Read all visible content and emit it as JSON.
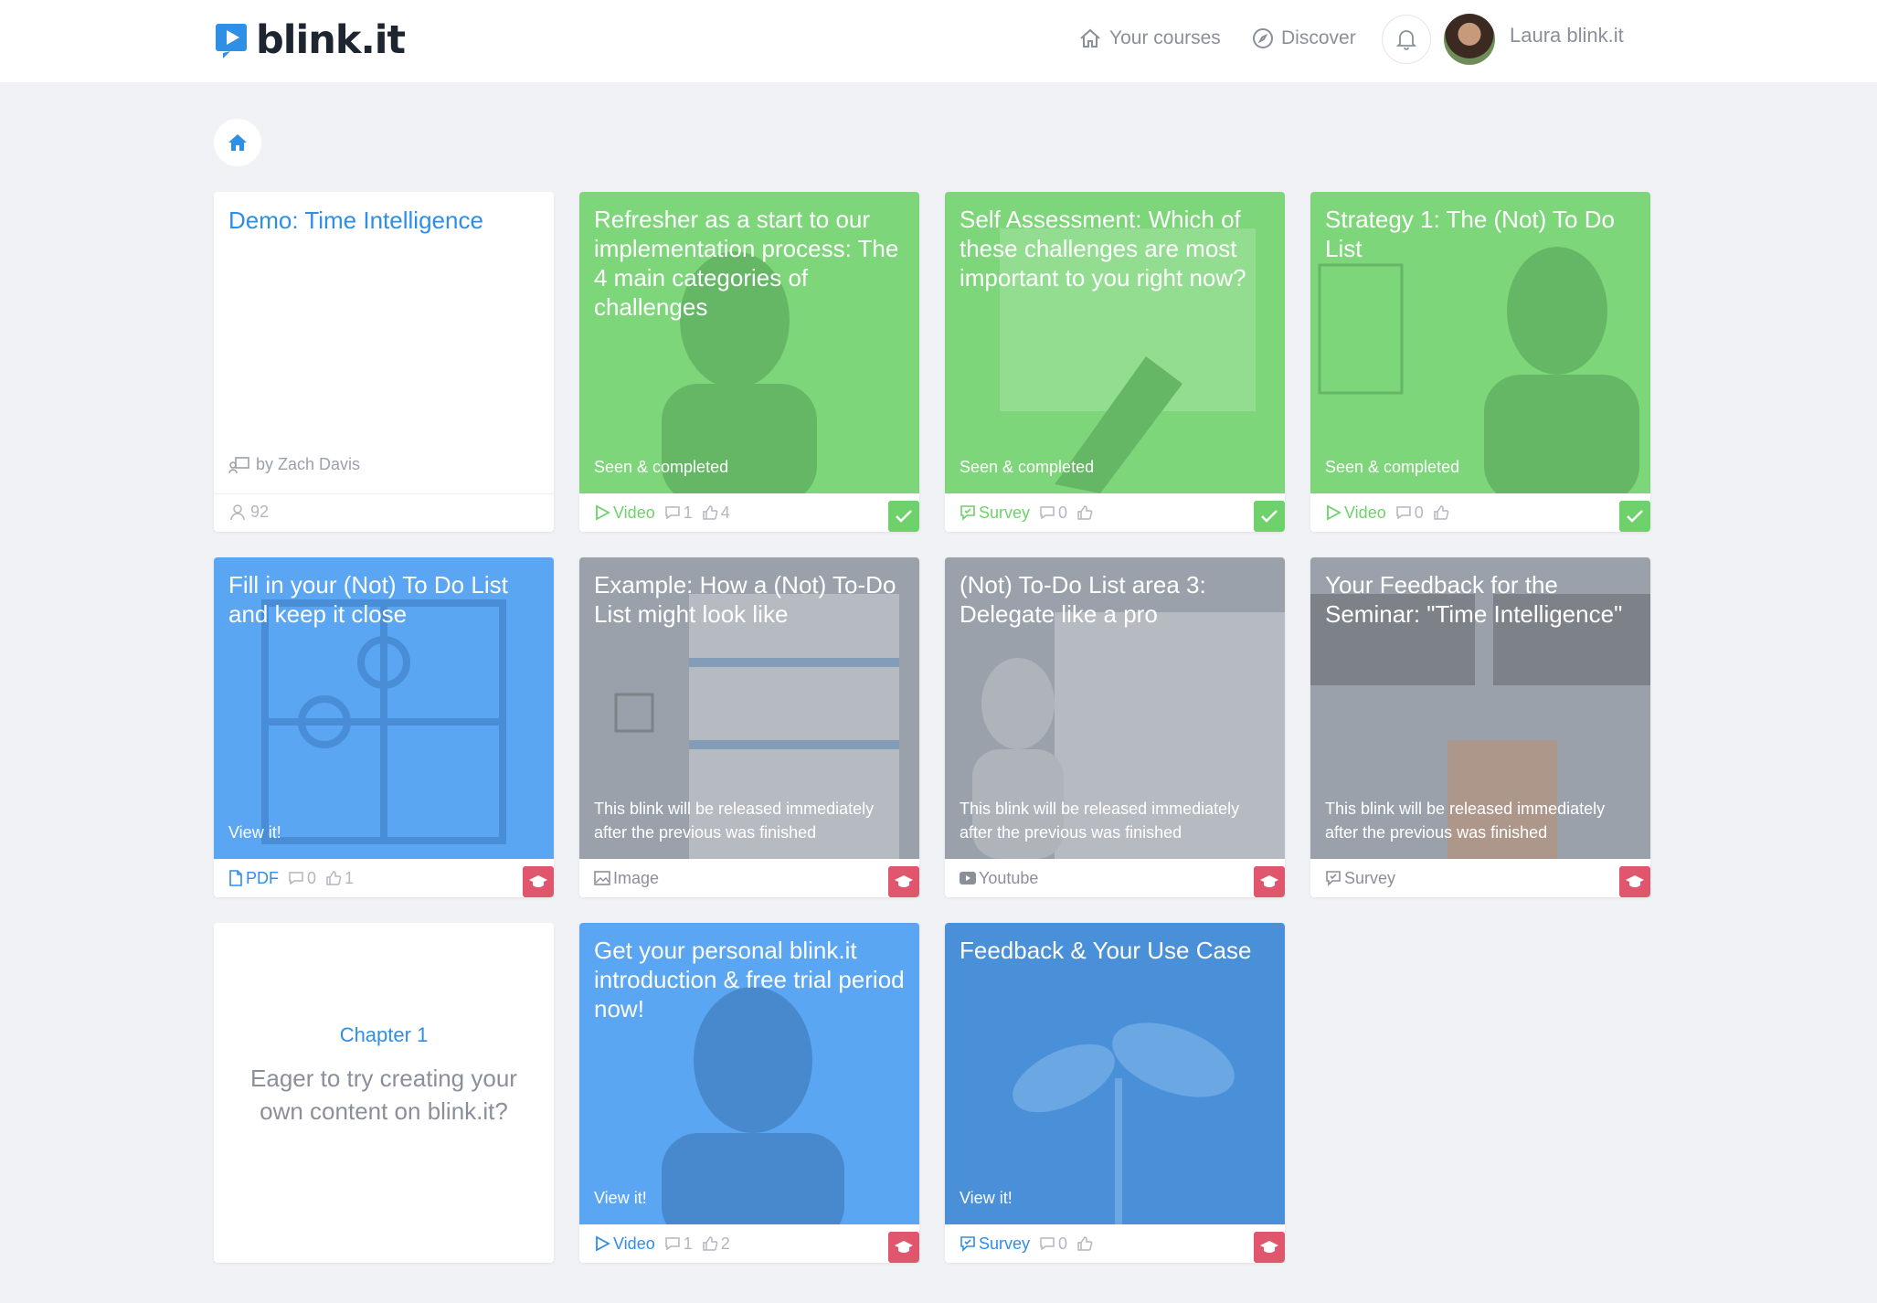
{
  "header": {
    "logo_text": "blink.it",
    "brand_color": "#2f8ee6",
    "nav": [
      {
        "label": "Your courses",
        "icon": "home-outline-icon"
      },
      {
        "label": "Discover",
        "icon": "compass-icon"
      }
    ],
    "user_name": "Laura blink.it"
  },
  "intro_card": {
    "title": "Demo: Time Intelligence",
    "author": "by Zach Davis",
    "views": "92"
  },
  "cards": [
    {
      "title": "Refresher as a start to our implementation process: The 4 main categories of challenges",
      "status": "Seen & completed",
      "type": "Video",
      "comments": "1",
      "likes": "4",
      "badge": "completed",
      "theme": "green"
    },
    {
      "title": "Self Assessment: Which of these challenges are most important to you right now?",
      "status": "Seen & completed",
      "type": "Survey",
      "comments": "0",
      "likes": "",
      "badge": "completed",
      "theme": "green"
    },
    {
      "title": "Strategy 1: The (Not) To Do List",
      "status": "Seen & completed",
      "type": "Video",
      "comments": "0",
      "likes": "",
      "badge": "completed",
      "theme": "green"
    },
    {
      "title": "Fill in your (Not) To Do List and keep it close",
      "status": "View it!",
      "type": "PDF",
      "comments": "0",
      "likes": "1",
      "badge": "locked",
      "theme": "blue"
    },
    {
      "title": "Example: How a (Not) To-Do List might look like",
      "status": "This blink will be released immediately after the previous was finished",
      "type": "Image",
      "badge": "locked",
      "theme": "gray"
    },
    {
      "title": "(Not) To-Do List area 3: Delegate like a pro",
      "status": "This blink will be released immediately after the previous was finished",
      "type": "Youtube",
      "badge": "locked",
      "theme": "gray"
    },
    {
      "title": "Your Feedback for the Seminar: \"Time Intelligence\"",
      "status": "This blink will be released immediately after the previous was finished",
      "type": "Survey",
      "badge": "locked",
      "theme": "gray"
    },
    {
      "title": "Get your personal blink.it introduction & free trial period now!",
      "status": "View it!",
      "type": "Video",
      "comments": "1",
      "likes": "2",
      "badge": "locked",
      "theme": "blue"
    },
    {
      "title": "Feedback & Your Use Case",
      "status": "View it!",
      "type": "Survey",
      "comments": "0",
      "likes": "",
      "badge": "locked",
      "theme": "blue"
    }
  ],
  "chapter_card": {
    "label": "Chapter 1",
    "text": "Eager to try creating your own content on blink.it?"
  },
  "colors": {
    "completed": "#6fd16b",
    "locked": "#e0566d",
    "green": "#7ed67a",
    "gray": "#9aa1aa",
    "blue": "#5aa6f2"
  }
}
